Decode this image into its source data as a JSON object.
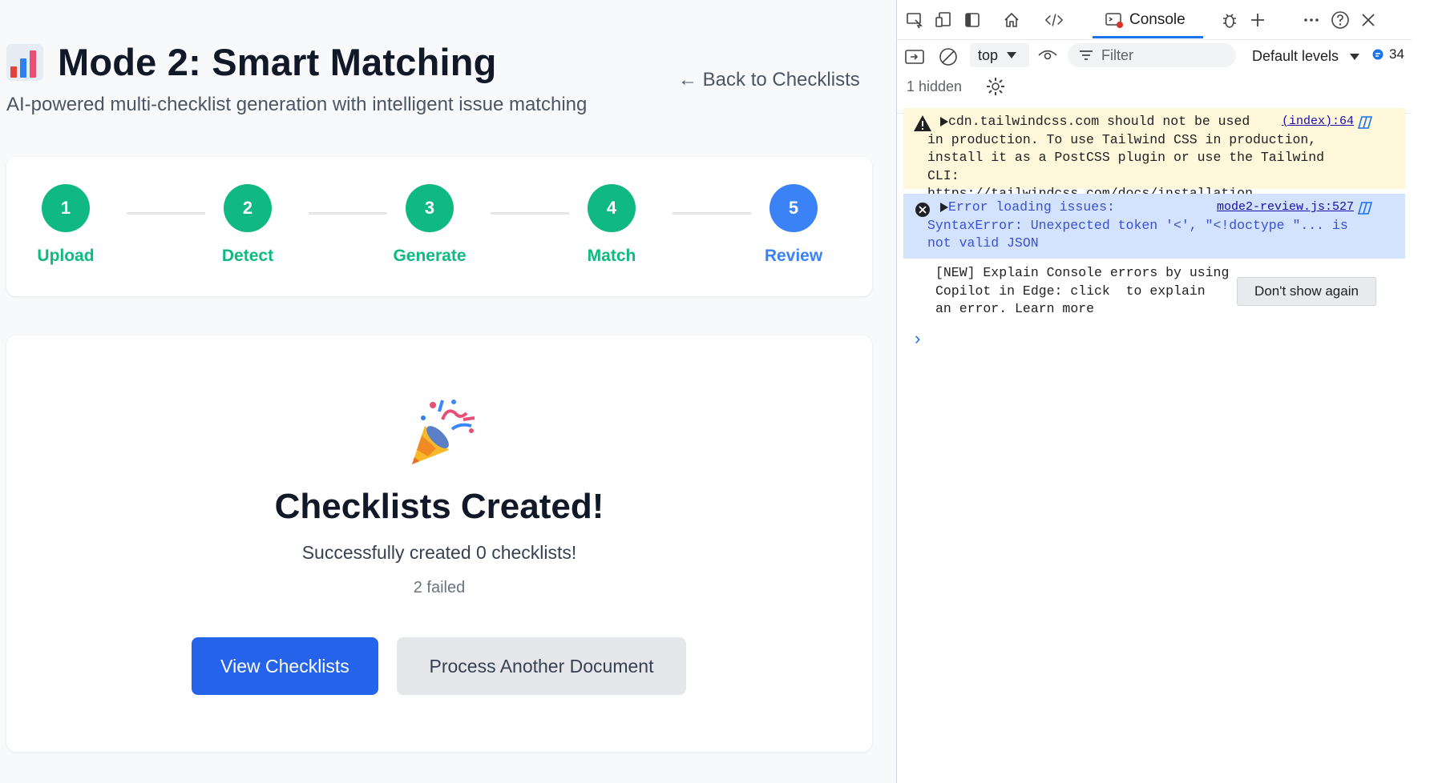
{
  "app": {
    "title": "Mode 2: Smart Matching",
    "subtitle": "AI-powered multi-checklist generation with intelligent issue matching",
    "back_link": "← Back to Checklists",
    "steps": [
      {
        "number": "1",
        "label": "Upload",
        "state": "done"
      },
      {
        "number": "2",
        "label": "Detect",
        "state": "done"
      },
      {
        "number": "3",
        "label": "Generate",
        "state": "done"
      },
      {
        "number": "4",
        "label": "Match",
        "state": "done"
      },
      {
        "number": "5",
        "label": "Review",
        "state": "current"
      }
    ],
    "result": {
      "title": "Checklists Created!",
      "message": "Successfully created 0 checklists!",
      "failed": "2 failed",
      "primary_button": "View Checklists",
      "secondary_button": "Process Another Document"
    },
    "colors": {
      "done": "#10b981",
      "current": "#3b82f6",
      "primary": "#2563eb"
    }
  },
  "devtools": {
    "active_tab": "Console",
    "context": "top",
    "filter_placeholder": "Filter",
    "levels": "Default levels",
    "issues_count": "34",
    "hidden": "1 hidden",
    "messages": [
      {
        "type": "warning",
        "text": "cdn.tailwindcss.com should not be used\nin production. To use Tailwind CSS in production,\ninstall it as a PostCSS plugin or use the Tailwind CLI:\nhttps://tailwindcss.com/docs/installation",
        "source": "(index):64"
      },
      {
        "type": "error",
        "text": "Error loading issues:\nSyntaxError: Unexpected token '<', \"<!doctype \"... is\nnot valid JSON",
        "source": "mode2-review.js:527"
      }
    ],
    "tip": "[NEW] Explain Console errors by using\nCopilot in Edge: click  to explain\nan error. Learn more",
    "dont_show_button": "Don't show again"
  }
}
